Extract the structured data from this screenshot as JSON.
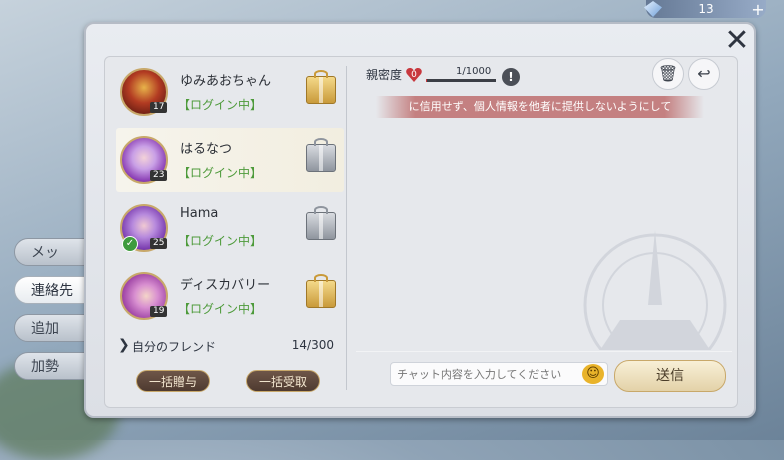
{
  "currency": {
    "amount": "13",
    "plus": "+"
  },
  "side_tabs": [
    {
      "label": "メッ",
      "active": false
    },
    {
      "label": "連絡先",
      "active": true
    },
    {
      "label": "追加",
      "active": false
    },
    {
      "label": "加勢",
      "active": false
    }
  ],
  "close_label": "✕",
  "friends": [
    {
      "name": "ゆみあおちゃん",
      "status": "【ログイン中】",
      "level": "17",
      "gift": "gold"
    },
    {
      "name": "はるなつ",
      "status": "【ログイン中】",
      "level": "23",
      "gift": "silver"
    },
    {
      "name": "Hama",
      "status": "【ログイン中】",
      "level": "25",
      "gift": "silver"
    },
    {
      "name": "ディスカバリー",
      "status": "【ログイン中】",
      "level": "19",
      "gift": "gold"
    }
  ],
  "my_friends": {
    "chevron": "❯",
    "label": "自分のフレンド",
    "count": "14/300"
  },
  "buttons": {
    "gift_all": "一括贈与",
    "receive_all": "一括受取",
    "send": "送信"
  },
  "chat": {
    "intimacy_label": "親密度",
    "intimacy_level": "0",
    "intimacy_value": "1/1000",
    "intimacy_fraction": 0.001,
    "info": "!",
    "warning": "に信用せず、個人情報を他者に提供しないようにして",
    "input_placeholder": "チャット内容を入力してください",
    "emoji": "☺",
    "delete_icon": "🗑",
    "back_icon": "↩"
  }
}
